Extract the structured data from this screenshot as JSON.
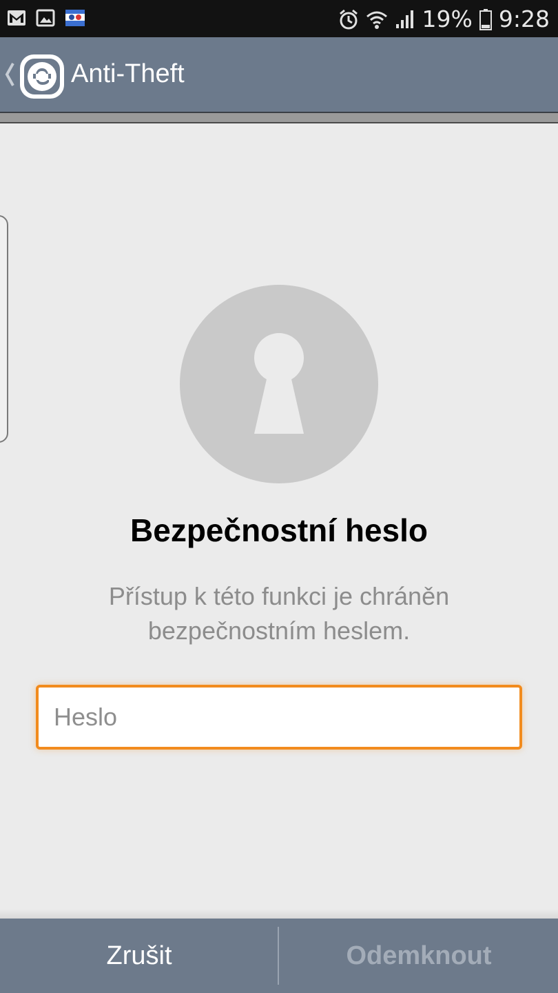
{
  "status_bar": {
    "icons_left": [
      "gmail-icon",
      "gallery-icon",
      "app-notification-icon"
    ],
    "icons_right": [
      "alarm-icon",
      "wifi-icon",
      "signal-icon",
      "battery-icon"
    ],
    "battery": "19%",
    "time": "9:28"
  },
  "action_bar": {
    "logo_icon": "eset-e-logo-icon",
    "title": "Anti-Theft"
  },
  "main": {
    "lock_icon": "keyhole-icon",
    "heading": "Bezpečnostní heslo",
    "description": "Přístup k této funkci je chráněn bezpečnostním heslem.",
    "password_field": {
      "placeholder": "Heslo",
      "value": ""
    }
  },
  "buttons": {
    "cancel_label": "Zrušit",
    "unlock_label": "Odemknout"
  },
  "colors": {
    "accent": "#f28b1d",
    "bar": "#6c7a8c",
    "background": "#ebebeb"
  }
}
